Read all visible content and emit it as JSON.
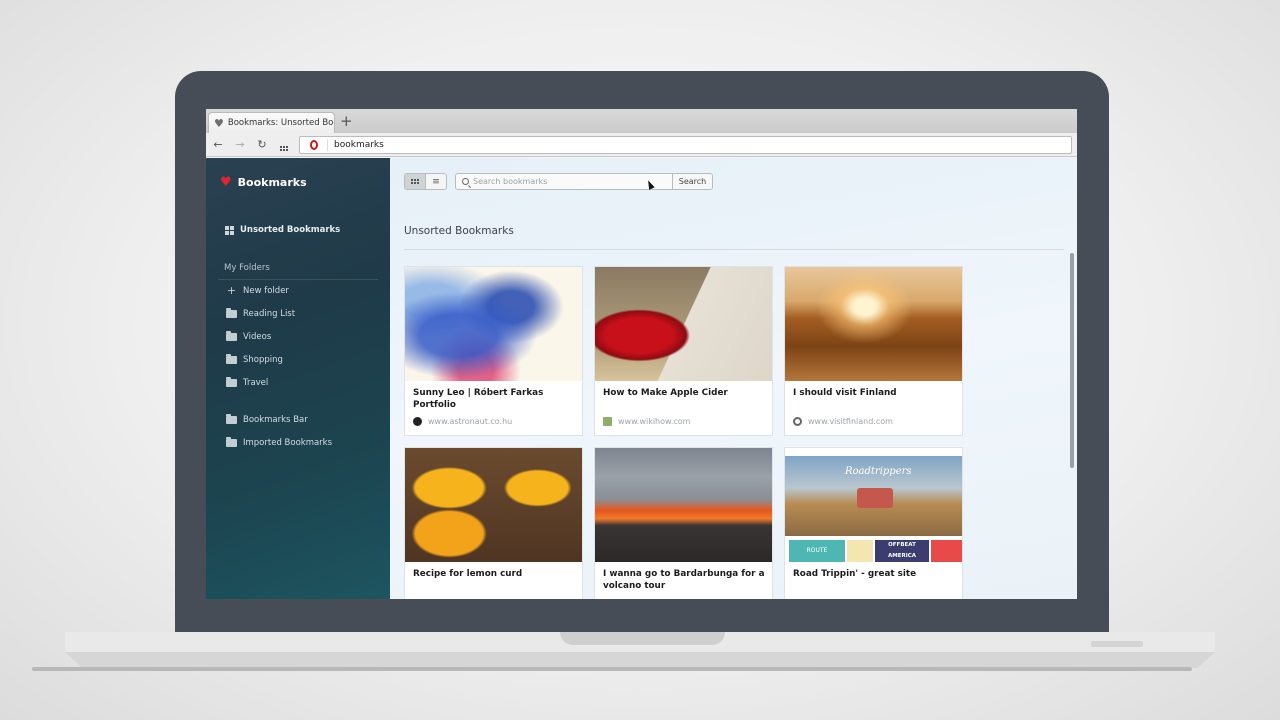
{
  "browser": {
    "tab_title": "Bookmarks: Unsorted Bookm",
    "new_tab_label": "+",
    "address": "bookmarks",
    "nav": {
      "back": "←",
      "forward": "→",
      "reload": "↻"
    }
  },
  "sidebar": {
    "title": "Bookmarks",
    "unsorted": "Unsorted Bookmarks",
    "section_label": "My Folders",
    "new_folder": "New folder",
    "folders": [
      "Reading List",
      "Videos",
      "Shopping",
      "Travel"
    ],
    "other_folders": [
      "Bookmarks Bar",
      "Imported Bookmarks"
    ]
  },
  "main": {
    "search_placeholder": "Search bookmarks",
    "search_button": "Search",
    "heading": "Unsorted Bookmarks",
    "view_mode": "grid",
    "cards": [
      {
        "title": "Sunny Leo | Róbert Farkas Portfolio",
        "url": "www.astronaut.co.hu",
        "favicon": "astronaut-icon",
        "favicon_color": "#222222"
      },
      {
        "title": "How to Make Apple Cider",
        "url": "www.wikihow.com",
        "favicon": "wikihow-icon",
        "favicon_color": "#8fae6a"
      },
      {
        "title": "I should visit Finland",
        "url": "www.visitfinland.com",
        "favicon": "visitfinland-icon",
        "favicon_color": "#666666"
      },
      {
        "title": "Recipe for lemon curd",
        "url": "",
        "favicon": "",
        "favicon_color": ""
      },
      {
        "title": "I wanna go to Bardarbunga for a volcano tour",
        "url": "",
        "favicon": "",
        "favicon_color": ""
      },
      {
        "title": "Road Trippin' - great site",
        "url": "",
        "favicon": "",
        "favicon_color": ""
      }
    ],
    "roadtrippers_thumb": {
      "logo": "Roadtrippers",
      "tile_1": "ROUTE",
      "tile_2": "OFFBEAT AMERICA"
    }
  },
  "colors": {
    "accent_heart": "#e0262c",
    "opera_red": "#cc1a1a",
    "laptop_frame": "#464d57"
  }
}
